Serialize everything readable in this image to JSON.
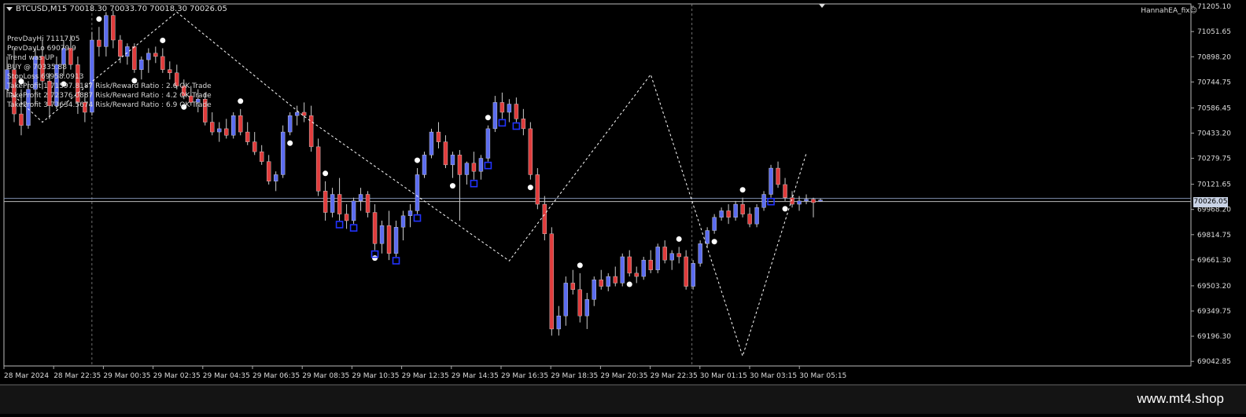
{
  "header": {
    "symbol": "BTCUSD,M15",
    "ohlc": "70018.30 70033.70 70018.30 70026.05"
  },
  "ea_label": "HannahEA_fix☺",
  "info_lines": [
    "PrevDayHi 71117.05",
    "PrevDayLo 69079.9",
    "Trend was UP",
    "BUY @ 70335.88",
    "StopLoss 69958.0913",
    "TakeProfit 1 71597.8187 Risk/Reward Ratio : 2.6 OK Trade",
    "TakeProfit 2 72376.0887 Risk/Reward Ratio : 4.2 OK Trade",
    "TakeProfit 3 73634.5674 Risk/Reward Ratio : 6.9 OK Trade"
  ],
  "current_price_label": "70026.05",
  "watermark": "www.mt4.shop",
  "colors": {
    "bull": "#5b6cf0",
    "bear": "#e03c3c",
    "grid": "#888888",
    "price_line": "#7f8fb0",
    "zigzag": "#ffffff",
    "background": "#000000"
  },
  "chart_data": {
    "type": "candlestick",
    "title": "BTCUSD,M15",
    "y_ticks": [
      "71205.10",
      "71051.65",
      "70898.20",
      "70744.75",
      "70586.45",
      "70433.20",
      "70279.75",
      "70121.65",
      "69968.20",
      "69814.75",
      "69661.30",
      "69503.20",
      "69349.75",
      "69196.30",
      "69042.85"
    ],
    "x_ticks": [
      "28 Mar 2024",
      "28 Mar 22:35",
      "29 Mar 00:35",
      "29 Mar 02:35",
      "29 Mar 04:35",
      "29 Mar 06:35",
      "29 Mar 08:35",
      "29 Mar 10:35",
      "29 Mar 12:35",
      "29 Mar 14:35",
      "29 Mar 16:35",
      "29 Mar 18:35",
      "29 Mar 20:35",
      "29 Mar 22:35",
      "30 Mar 01:15",
      "30 Mar 03:15",
      "30 Mar 05:15"
    ],
    "ylim": [
      69015,
      71220
    ],
    "horizontal_line": 70026.05,
    "zigzag_points": [
      {
        "x": "28 Mar 2024",
        "y": 70700
      },
      {
        "x": "28 Mar 21:45",
        "y": 70500
      },
      {
        "x": "29 Mar 01:00",
        "y": 71170
      },
      {
        "x": "29 Mar 07:00",
        "y": 70535
      },
      {
        "x": "29 Mar 12:00",
        "y": 69655
      },
      {
        "x": "29 Mar 16:45",
        "y": 70790
      },
      {
        "x": "29 Mar 18:40",
        "y": 69075
      },
      {
        "x": "30 Mar 03:30",
        "y": 70310
      }
    ],
    "candles": [
      [
        70700,
        70900,
        70650,
        70820
      ],
      [
        70820,
        70950,
        70500,
        70550
      ],
      [
        70550,
        70700,
        70420,
        70480
      ],
      [
        70480,
        70750,
        70460,
        70700
      ],
      [
        70700,
        70950,
        70600,
        70900
      ],
      [
        70900,
        71000,
        70700,
        70750
      ],
      [
        70750,
        70800,
        70520,
        70600
      ],
      [
        70600,
        70900,
        70580,
        70850
      ],
      [
        70850,
        71000,
        70780,
        70950
      ],
      [
        70950,
        71030,
        70820,
        70850
      ],
      [
        70850,
        70900,
        70550,
        70620
      ],
      [
        70620,
        70680,
        70500,
        70560
      ],
      [
        70560,
        71050,
        70540,
        71000
      ],
      [
        71000,
        71080,
        70900,
        70960
      ],
      [
        70960,
        71170,
        70900,
        71150
      ],
      [
        71150,
        71180,
        70950,
        71000
      ],
      [
        71000,
        71030,
        70860,
        70900
      ],
      [
        70900,
        70980,
        70850,
        70960
      ],
      [
        70960,
        70980,
        70800,
        70820
      ],
      [
        70820,
        70900,
        70760,
        70880
      ],
      [
        70880,
        70950,
        70800,
        70920
      ],
      [
        70920,
        70960,
        70860,
        70900
      ],
      [
        70900,
        70950,
        70800,
        70820
      ],
      [
        70820,
        70870,
        70760,
        70800
      ],
      [
        70800,
        70850,
        70700,
        70720
      ],
      [
        70720,
        70760,
        70640,
        70660
      ],
      [
        70660,
        70720,
        70600,
        70620
      ],
      [
        70620,
        70700,
        70560,
        70640
      ],
      [
        70640,
        70680,
        70480,
        70500
      ],
      [
        70500,
        70560,
        70420,
        70440
      ],
      [
        70440,
        70500,
        70380,
        70460
      ],
      [
        70460,
        70520,
        70400,
        70420
      ],
      [
        70420,
        70560,
        70400,
        70540
      ],
      [
        70540,
        70580,
        70420,
        70440
      ],
      [
        70440,
        70500,
        70360,
        70380
      ],
      [
        70380,
        70440,
        70300,
        70320
      ],
      [
        70320,
        70360,
        70240,
        70260
      ],
      [
        70260,
        70300,
        70120,
        70140
      ],
      [
        70140,
        70200,
        70080,
        70180
      ],
      [
        70180,
        70480,
        70160,
        70440
      ],
      [
        70440,
        70560,
        70420,
        70540
      ],
      [
        70540,
        70600,
        70480,
        70560
      ],
      [
        70560,
        70620,
        70500,
        70540
      ],
      [
        70540,
        70600,
        70320,
        70350
      ],
      [
        70350,
        70400,
        70050,
        70080
      ],
      [
        70080,
        70140,
        69900,
        69950
      ],
      [
        69950,
        70100,
        69920,
        70060
      ],
      [
        70060,
        70160,
        69900,
        69940
      ],
      [
        69940,
        70000,
        69850,
        69900
      ],
      [
        69900,
        70040,
        69880,
        70020
      ],
      [
        70020,
        70100,
        69960,
        70060
      ],
      [
        70060,
        70080,
        69920,
        69950
      ],
      [
        69950,
        70000,
        69720,
        69760
      ],
      [
        69760,
        69900,
        69700,
        69870
      ],
      [
        69870,
        69960,
        69660,
        69700
      ],
      [
        69700,
        69900,
        69680,
        69860
      ],
      [
        69860,
        69960,
        69780,
        69930
      ],
      [
        69930,
        70000,
        69860,
        69960
      ],
      [
        69960,
        70220,
        69940,
        70180
      ],
      [
        70180,
        70320,
        70160,
        70300
      ],
      [
        70300,
        70460,
        70280,
        70440
      ],
      [
        70440,
        70500,
        70340,
        70380
      ],
      [
        70380,
        70420,
        70220,
        70240
      ],
      [
        70240,
        70320,
        70160,
        70300
      ],
      [
        70300,
        70330,
        69900,
        70180
      ],
      [
        70180,
        70260,
        70120,
        70250
      ],
      [
        70250,
        70320,
        70150,
        70200
      ],
      [
        70200,
        70300,
        70150,
        70280
      ],
      [
        70280,
        70480,
        70260,
        70460
      ],
      [
        70460,
        70660,
        70440,
        70620
      ],
      [
        70620,
        70680,
        70520,
        70560
      ],
      [
        70560,
        70640,
        70500,
        70610
      ],
      [
        70610,
        70650,
        70500,
        70520
      ],
      [
        70520,
        70580,
        70420,
        70460
      ],
      [
        70460,
        70500,
        70150,
        70180
      ],
      [
        70180,
        70220,
        69970,
        70000
      ],
      [
        70000,
        70050,
        69780,
        69820
      ],
      [
        69820,
        69860,
        69200,
        69240
      ],
      [
        69240,
        69380,
        69200,
        69320
      ],
      [
        69320,
        69560,
        69260,
        69520
      ],
      [
        69520,
        69600,
        69450,
        69480
      ],
      [
        69480,
        69580,
        69280,
        69320
      ],
      [
        69320,
        69460,
        69240,
        69420
      ],
      [
        69420,
        69560,
        69380,
        69540
      ],
      [
        69540,
        69600,
        69480,
        69500
      ],
      [
        69500,
        69580,
        69470,
        69560
      ],
      [
        69560,
        69620,
        69500,
        69520
      ],
      [
        69520,
        69700,
        69500,
        69680
      ],
      [
        69680,
        69720,
        69560,
        69580
      ],
      [
        69580,
        69620,
        69520,
        69560
      ],
      [
        69560,
        69680,
        69540,
        69660
      ],
      [
        69660,
        69720,
        69580,
        69600
      ],
      [
        69600,
        69760,
        69580,
        69740
      ],
      [
        69740,
        69780,
        69640,
        69660
      ],
      [
        69660,
        69720,
        69600,
        69700
      ],
      [
        69700,
        69740,
        69640,
        69680
      ],
      [
        69680,
        69720,
        69480,
        69500
      ],
      [
        69500,
        69660,
        69480,
        69640
      ],
      [
        69640,
        69780,
        69620,
        69760
      ],
      [
        69760,
        69860,
        69740,
        69840
      ],
      [
        69840,
        69940,
        69820,
        69920
      ],
      [
        69920,
        69980,
        69900,
        69960
      ],
      [
        69960,
        70000,
        69880,
        69920
      ],
      [
        69920,
        70020,
        69900,
        70000
      ],
      [
        70000,
        70040,
        69920,
        69940
      ],
      [
        69940,
        69980,
        69860,
        69880
      ],
      [
        69880,
        70000,
        69860,
        69980
      ],
      [
        69980,
        70080,
        69960,
        70060
      ],
      [
        70060,
        70240,
        70040,
        70220
      ],
      [
        70220,
        70260,
        70100,
        70120
      ],
      [
        70120,
        70160,
        70020,
        70040
      ],
      [
        70040,
        70080,
        69980,
        70000
      ],
      [
        70000,
        70050,
        69960,
        70020
      ],
      [
        70020,
        70060,
        70000,
        70030
      ],
      [
        70030,
        70040,
        69920,
        70010
      ],
      [
        70018.3,
        70033.7,
        70018.3,
        70026.05
      ]
    ]
  }
}
